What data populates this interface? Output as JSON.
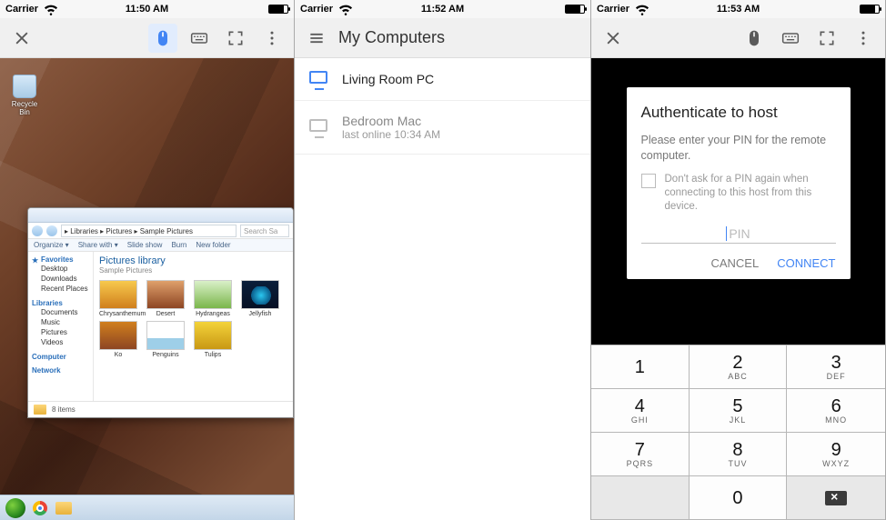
{
  "paneA": {
    "status": {
      "carrier": "Carrier",
      "time": "11:50 AM"
    },
    "desktop": {
      "recycle": "Recycle Bin"
    },
    "explorer": {
      "path": "▸ Libraries ▸ Pictures ▸ Sample Pictures",
      "search": "Search Sa",
      "menu": {
        "organize": "Organize ▾",
        "share": "Share with ▾",
        "slideshow": "Slide show",
        "burn": "Burn",
        "newfolder": "New folder"
      },
      "side": {
        "fav": "Favorites",
        "fav_items": [
          "Desktop",
          "Downloads",
          "Recent Places"
        ],
        "lib": "Libraries",
        "lib_items": [
          "Documents",
          "Music",
          "Pictures",
          "Videos"
        ],
        "comp": "Computer",
        "net": "Network"
      },
      "libtitle": "Pictures library",
      "libsub": "Sample Pictures",
      "thumbs": [
        "Chrysanthemum",
        "Desert",
        "Hydrangeas",
        "Jellyfish",
        "Ko",
        "Penguins",
        "Tulips"
      ],
      "statusbar": "8 items"
    }
  },
  "paneB": {
    "status": {
      "carrier": "Carrier",
      "time": "11:52 AM"
    },
    "title": "My Computers",
    "hosts": [
      {
        "name": "Living Room PC",
        "sub": "",
        "online": true
      },
      {
        "name": "Bedroom Mac",
        "sub": "last online 10:34 AM",
        "online": false
      }
    ]
  },
  "paneC": {
    "status": {
      "carrier": "Carrier",
      "time": "11:53 AM"
    },
    "dialog": {
      "title": "Authenticate to host",
      "text": "Please enter your PIN for the remote computer.",
      "checkbox": "Don't ask for a PIN again when connecting to this host from this device.",
      "placeholder": "PIN",
      "cancel": "CANCEL",
      "connect": "CONNECT"
    },
    "keypad": [
      {
        "n": "1",
        "l": ""
      },
      {
        "n": "2",
        "l": "ABC"
      },
      {
        "n": "3",
        "l": "DEF"
      },
      {
        "n": "4",
        "l": "GHI"
      },
      {
        "n": "5",
        "l": "JKL"
      },
      {
        "n": "6",
        "l": "MNO"
      },
      {
        "n": "7",
        "l": "PQRS"
      },
      {
        "n": "8",
        "l": "TUV"
      },
      {
        "n": "9",
        "l": "WXYZ"
      }
    ],
    "zero": "0"
  }
}
